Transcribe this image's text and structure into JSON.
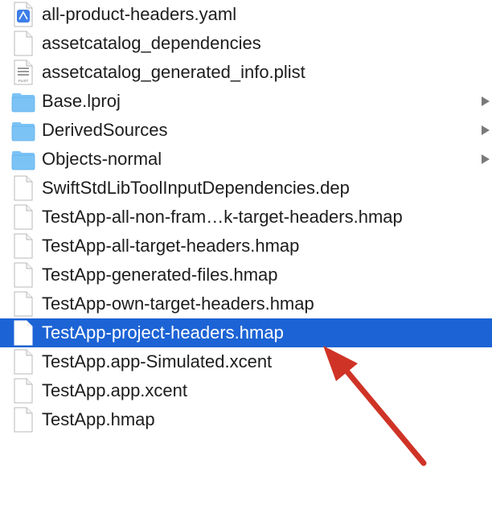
{
  "files": [
    {
      "name": "all-product-headers.yaml",
      "icon": "yaml-file-icon",
      "kind": "yaml",
      "selected": false,
      "expandable": false
    },
    {
      "name": "assetcatalog_dependencies",
      "icon": "generic-file-icon",
      "kind": "doc",
      "selected": false,
      "expandable": false
    },
    {
      "name": "assetcatalog_generated_info.plist",
      "icon": "plist-file-icon",
      "kind": "plist",
      "selected": false,
      "expandable": false
    },
    {
      "name": "Base.lproj",
      "icon": "folder-icon",
      "kind": "folder",
      "selected": false,
      "expandable": true
    },
    {
      "name": "DerivedSources",
      "icon": "folder-icon",
      "kind": "folder",
      "selected": false,
      "expandable": true
    },
    {
      "name": "Objects-normal",
      "icon": "folder-icon",
      "kind": "folder",
      "selected": false,
      "expandable": true
    },
    {
      "name": "SwiftStdLibToolInputDependencies.dep",
      "icon": "generic-file-icon",
      "kind": "doc",
      "selected": false,
      "expandable": false
    },
    {
      "name": "TestApp-all-non-fram…k-target-headers.hmap",
      "icon": "generic-file-icon",
      "kind": "doc",
      "selected": false,
      "expandable": false
    },
    {
      "name": "TestApp-all-target-headers.hmap",
      "icon": "generic-file-icon",
      "kind": "doc",
      "selected": false,
      "expandable": false
    },
    {
      "name": "TestApp-generated-files.hmap",
      "icon": "generic-file-icon",
      "kind": "doc",
      "selected": false,
      "expandable": false
    },
    {
      "name": "TestApp-own-target-headers.hmap",
      "icon": "generic-file-icon",
      "kind": "doc",
      "selected": false,
      "expandable": false
    },
    {
      "name": "TestApp-project-headers.hmap",
      "icon": "generic-file-icon",
      "kind": "doc",
      "selected": true,
      "expandable": false
    },
    {
      "name": "TestApp.app-Simulated.xcent",
      "icon": "generic-file-icon",
      "kind": "doc",
      "selected": false,
      "expandable": false
    },
    {
      "name": "TestApp.app.xcent",
      "icon": "generic-file-icon",
      "kind": "doc",
      "selected": false,
      "expandable": false
    },
    {
      "name": "TestApp.hmap",
      "icon": "generic-file-icon",
      "kind": "doc",
      "selected": false,
      "expandable": false
    }
  ],
  "plist_badge": "PLIST",
  "colors": {
    "selection": "#1c63d5",
    "folder": "#7cc3f5",
    "annotation_arrow": "#cf3326"
  }
}
